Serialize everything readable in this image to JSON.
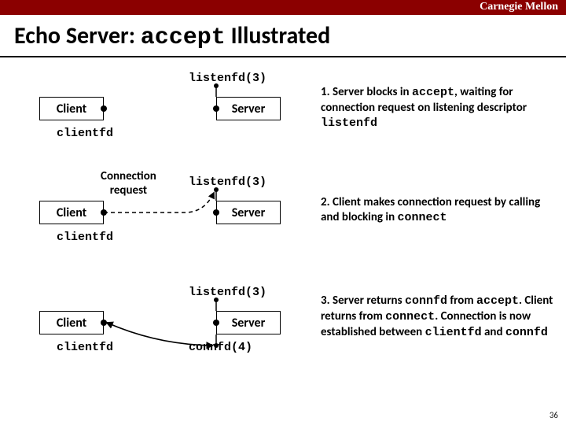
{
  "header": {
    "org": "Carnegie Mellon"
  },
  "title": {
    "pre": "Echo Server: ",
    "code": "accept",
    "post": " Illustrated"
  },
  "labels": {
    "client": "Client",
    "server": "Server",
    "listenfd": "listenfd(3)",
    "clientfd": "clientfd",
    "connreq": "Connection\nrequest",
    "connfd": "connfd(4)"
  },
  "captions": {
    "c1a": "1. Server blocks in ",
    "c1code1": "accept",
    "c1b": ", waiting for connection request on listening descriptor ",
    "c1code2": "listenfd",
    "c2a": "2. Client makes connection request by calling and blocking in ",
    "c2code": "connect",
    "c3a": "3. Server returns ",
    "c3code1": "connfd",
    "c3b": " from ",
    "c3code2": "accept",
    "c3c": ". Client returns from ",
    "c3code3": "connect",
    "c3d": ". Connection is now established between ",
    "c3code4": "clientfd",
    "c3e": " and ",
    "c3code5": "connfd"
  },
  "footer": {
    "page": "36"
  }
}
